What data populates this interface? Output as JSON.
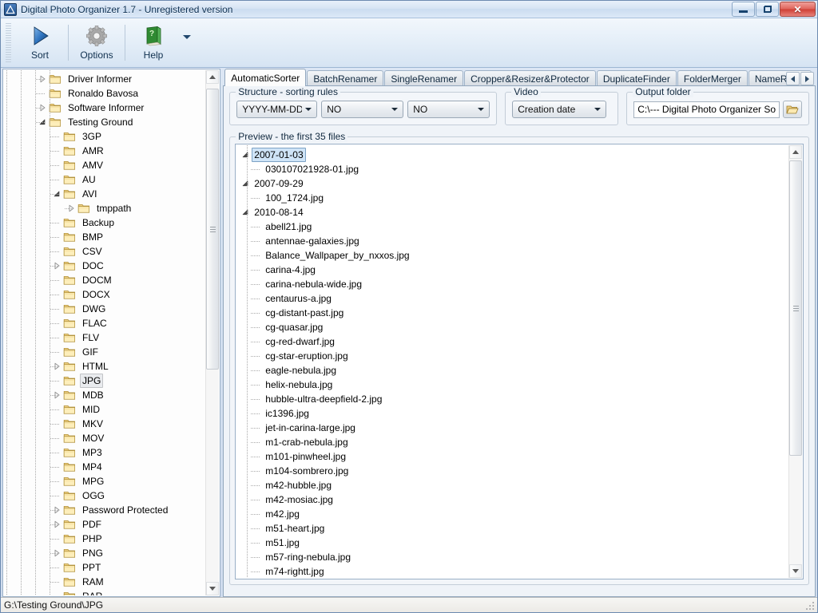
{
  "window": {
    "title": "Digital Photo Organizer 1.7 - Unregistered version",
    "app_icon": "triangle-logo-icon",
    "minimize_label": "Minimize",
    "restore_label": "Restore",
    "close_label": "Close",
    "close_glyph": "✕"
  },
  "toolbar": {
    "buttons": [
      {
        "label": "Sort",
        "icon": "play-triangle-icon"
      },
      {
        "label": "Options",
        "icon": "gear-icon"
      },
      {
        "label": "Help",
        "icon": "green-book-icon"
      }
    ],
    "overflow_icon": "chevron-down-icon"
  },
  "tree": {
    "nodes": [
      {
        "label": "Driver Informer",
        "depth": 1,
        "state": "collapsed",
        "selected": false
      },
      {
        "label": "Ronaldo Bavosa",
        "depth": 1,
        "state": "leaf",
        "selected": false
      },
      {
        "label": "Software Informer",
        "depth": 1,
        "state": "collapsed",
        "selected": false
      },
      {
        "label": "Testing Ground",
        "depth": 1,
        "state": "expanded",
        "selected": false
      },
      {
        "label": "3GP",
        "depth": 2,
        "state": "leaf",
        "selected": false
      },
      {
        "label": "AMR",
        "depth": 2,
        "state": "leaf",
        "selected": false
      },
      {
        "label": "AMV",
        "depth": 2,
        "state": "leaf",
        "selected": false
      },
      {
        "label": "AU",
        "depth": 2,
        "state": "leaf",
        "selected": false
      },
      {
        "label": "AVI",
        "depth": 2,
        "state": "expanded",
        "selected": false
      },
      {
        "label": "tmppath",
        "depth": 3,
        "state": "collapsed",
        "selected": false
      },
      {
        "label": "Backup",
        "depth": 2,
        "state": "leaf",
        "selected": false
      },
      {
        "label": "BMP",
        "depth": 2,
        "state": "leaf",
        "selected": false
      },
      {
        "label": "CSV",
        "depth": 2,
        "state": "leaf",
        "selected": false
      },
      {
        "label": "DOC",
        "depth": 2,
        "state": "collapsed",
        "selected": false
      },
      {
        "label": "DOCM",
        "depth": 2,
        "state": "leaf",
        "selected": false
      },
      {
        "label": "DOCX",
        "depth": 2,
        "state": "leaf",
        "selected": false
      },
      {
        "label": "DWG",
        "depth": 2,
        "state": "leaf",
        "selected": false
      },
      {
        "label": "FLAC",
        "depth": 2,
        "state": "leaf",
        "selected": false
      },
      {
        "label": "FLV",
        "depth": 2,
        "state": "leaf",
        "selected": false
      },
      {
        "label": "GIF",
        "depth": 2,
        "state": "leaf",
        "selected": false
      },
      {
        "label": "HTML",
        "depth": 2,
        "state": "collapsed",
        "selected": false
      },
      {
        "label": "JPG",
        "depth": 2,
        "state": "leaf",
        "selected": true
      },
      {
        "label": "MDB",
        "depth": 2,
        "state": "collapsed",
        "selected": false
      },
      {
        "label": "MID",
        "depth": 2,
        "state": "leaf",
        "selected": false
      },
      {
        "label": "MKV",
        "depth": 2,
        "state": "leaf",
        "selected": false
      },
      {
        "label": "MOV",
        "depth": 2,
        "state": "leaf",
        "selected": false
      },
      {
        "label": "MP3",
        "depth": 2,
        "state": "leaf",
        "selected": false
      },
      {
        "label": "MP4",
        "depth": 2,
        "state": "leaf",
        "selected": false
      },
      {
        "label": "MPG",
        "depth": 2,
        "state": "leaf",
        "selected": false
      },
      {
        "label": "OGG",
        "depth": 2,
        "state": "leaf",
        "selected": false
      },
      {
        "label": "Password Protected",
        "depth": 2,
        "state": "collapsed",
        "selected": false
      },
      {
        "label": "PDF",
        "depth": 2,
        "state": "collapsed",
        "selected": false
      },
      {
        "label": "PHP",
        "depth": 2,
        "state": "leaf",
        "selected": false
      },
      {
        "label": "PNG",
        "depth": 2,
        "state": "collapsed",
        "selected": false
      },
      {
        "label": "PPT",
        "depth": 2,
        "state": "leaf",
        "selected": false
      },
      {
        "label": "RAM",
        "depth": 2,
        "state": "leaf",
        "selected": false
      },
      {
        "label": "RAR",
        "depth": 2,
        "state": "leaf",
        "selected": false
      }
    ]
  },
  "tabs": [
    {
      "label": "AutomaticSorter",
      "active": true
    },
    {
      "label": "BatchRenamer",
      "active": false
    },
    {
      "label": "SingleRenamer",
      "active": false
    },
    {
      "label": "Cropper&Resizer&Protector",
      "active": false
    },
    {
      "label": "DuplicateFinder",
      "active": false
    },
    {
      "label": "FolderMerger",
      "active": false
    },
    {
      "label": "NameRepla",
      "active": false
    }
  ],
  "tab_scroll": {
    "left_icon": "scroll-left-icon",
    "right_icon": "scroll-right-icon"
  },
  "structure": {
    "title": "Structure - sorting rules",
    "dropdowns": [
      {
        "value": "YYYY-MM-DD"
      },
      {
        "value": "NO"
      },
      {
        "value": "NO"
      }
    ]
  },
  "video": {
    "title": "Video",
    "dropdown": {
      "value": "Creation date"
    }
  },
  "output": {
    "title": "Output folder",
    "path": "C:\\--- Digital Photo Organizer So",
    "browse_icon": "folder-open-icon"
  },
  "preview": {
    "title": "Preview - the first 35 files",
    "nodes": [
      {
        "label": "2007-01-03",
        "type": "group",
        "selected": true
      },
      {
        "label": "030107021928-01.jpg",
        "type": "file",
        "selected": false
      },
      {
        "label": "2007-09-29",
        "type": "group",
        "selected": false
      },
      {
        "label": "100_1724.jpg",
        "type": "file",
        "selected": false
      },
      {
        "label": "2010-08-14",
        "type": "group",
        "selected": false
      },
      {
        "label": "abell21.jpg",
        "type": "file",
        "selected": false
      },
      {
        "label": "antennae-galaxies.jpg",
        "type": "file",
        "selected": false
      },
      {
        "label": "Balance_Wallpaper_by_nxxos.jpg",
        "type": "file",
        "selected": false
      },
      {
        "label": "carina-4.jpg",
        "type": "file",
        "selected": false
      },
      {
        "label": "carina-nebula-wide.jpg",
        "type": "file",
        "selected": false
      },
      {
        "label": "centaurus-a.jpg",
        "type": "file",
        "selected": false
      },
      {
        "label": "cg-distant-past.jpg",
        "type": "file",
        "selected": false
      },
      {
        "label": "cg-quasar.jpg",
        "type": "file",
        "selected": false
      },
      {
        "label": "cg-red-dwarf.jpg",
        "type": "file",
        "selected": false
      },
      {
        "label": "cg-star-eruption.jpg",
        "type": "file",
        "selected": false
      },
      {
        "label": "eagle-nebula.jpg",
        "type": "file",
        "selected": false
      },
      {
        "label": "helix-nebula.jpg",
        "type": "file",
        "selected": false
      },
      {
        "label": "hubble-ultra-deepfield-2.jpg",
        "type": "file",
        "selected": false
      },
      {
        "label": "ic1396.jpg",
        "type": "file",
        "selected": false
      },
      {
        "label": "jet-in-carina-large.jpg",
        "type": "file",
        "selected": false
      },
      {
        "label": "m1-crab-nebula.jpg",
        "type": "file",
        "selected": false
      },
      {
        "label": "m101-pinwheel.jpg",
        "type": "file",
        "selected": false
      },
      {
        "label": "m104-sombrero.jpg",
        "type": "file",
        "selected": false
      },
      {
        "label": "m42-hubble.jpg",
        "type": "file",
        "selected": false
      },
      {
        "label": "m42-mosiac.jpg",
        "type": "file",
        "selected": false
      },
      {
        "label": "m42.jpg",
        "type": "file",
        "selected": false
      },
      {
        "label": "m51-heart.jpg",
        "type": "file",
        "selected": false
      },
      {
        "label": "m51.jpg",
        "type": "file",
        "selected": false
      },
      {
        "label": "m57-ring-nebula.jpg",
        "type": "file",
        "selected": false
      },
      {
        "label": "m74-rightt.jpg",
        "type": "file",
        "selected": false
      }
    ]
  },
  "status": {
    "path": "G:\\Testing Ground\\JPG"
  }
}
